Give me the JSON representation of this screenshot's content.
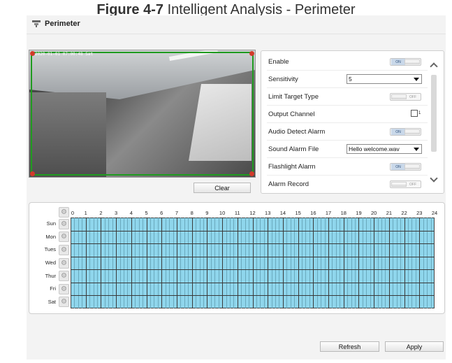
{
  "caption": {
    "figure_label": "Figure 4-7",
    "title": "Intelligent Analysis - Perimeter"
  },
  "header": {
    "title": "Perimeter",
    "icon": "perimeter-icon"
  },
  "video": {
    "osd_timestamp": "2020-01-01 07:00:48 Sat"
  },
  "buttons": {
    "clear": "Clear",
    "refresh": "Refresh",
    "apply": "Apply"
  },
  "settings": {
    "enable": {
      "label": "Enable",
      "state": "ON"
    },
    "sensitivity": {
      "label": "Sensitivity",
      "value": "5"
    },
    "limit_target_type": {
      "label": "Limit Target Type",
      "state": "OFF"
    },
    "output_channel": {
      "label": "Output Channel",
      "channel": "1"
    },
    "audio_detect_alarm": {
      "label": "Audio Detect Alarm",
      "state": "ON"
    },
    "sound_alarm_file": {
      "label": "Sound Alarm File",
      "value": "Hello welcome.wav"
    },
    "flashlight_alarm": {
      "label": "Flashlight Alarm",
      "state": "ON"
    },
    "alarm_record": {
      "label": "Alarm Record",
      "state": "OFF"
    }
  },
  "schedule": {
    "days": [
      "Sun",
      "Mon",
      "Tues",
      "Wed",
      "Thur",
      "Fri",
      "Sat"
    ],
    "hours": [
      "0",
      "1",
      "2",
      "3",
      "4",
      "5",
      "6",
      "7",
      "8",
      "9",
      "10",
      "11",
      "12",
      "13",
      "14",
      "15",
      "16",
      "17",
      "18",
      "19",
      "20",
      "21",
      "22",
      "23",
      "24"
    ],
    "all_selected": true,
    "fill_color": "#8fd6ec"
  },
  "colors": {
    "roi_border": "#1f9b1f",
    "grid_fill": "#8fd6ec",
    "toggle_on": "#c9d8e9"
  }
}
